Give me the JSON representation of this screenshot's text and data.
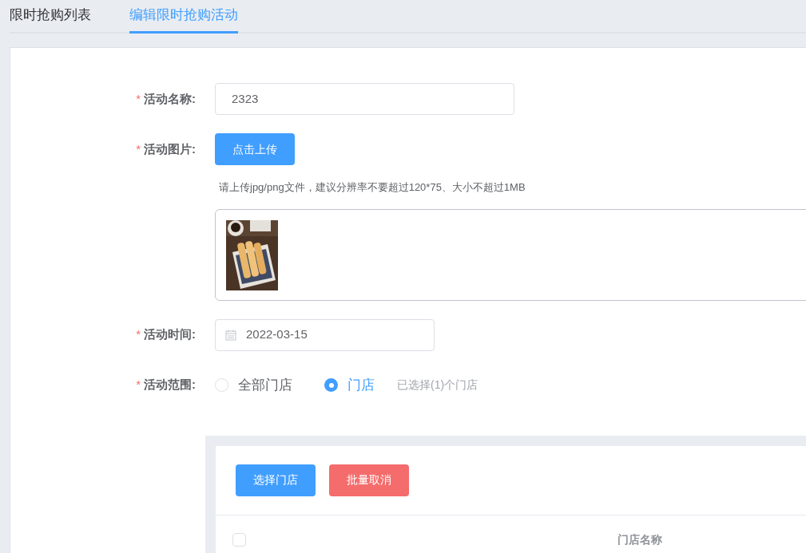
{
  "tabs": [
    {
      "label": "限时抢购列表",
      "selected": false
    },
    {
      "label": "编辑限时抢购活动",
      "selected": true
    }
  ],
  "form": {
    "name": {
      "label": "活动名称:",
      "required_mark": "*",
      "value": "2323"
    },
    "image": {
      "label": "活动图片:",
      "required_mark": "*",
      "button": "点击上传",
      "hint": "请上传jpg/png文件，建议分辨率不要超过120*75、大小不超过1MB"
    },
    "time": {
      "label": "活动时间:",
      "required_mark": "*",
      "value": "2022-03-15"
    },
    "scope": {
      "label": "活动范围:",
      "required_mark": "*",
      "options": [
        {
          "label": "全部门店",
          "selected": false
        },
        {
          "label": "门店",
          "selected": true
        }
      ],
      "note": "已选择(1)个门店"
    }
  },
  "store_table": {
    "buttons": [
      {
        "label": "选择门店",
        "kind": "primary"
      },
      {
        "label": "批量取消",
        "kind": "danger"
      }
    ],
    "header_checkbox": {
      "checked": false
    },
    "columns": [
      "门店名称"
    ]
  }
}
